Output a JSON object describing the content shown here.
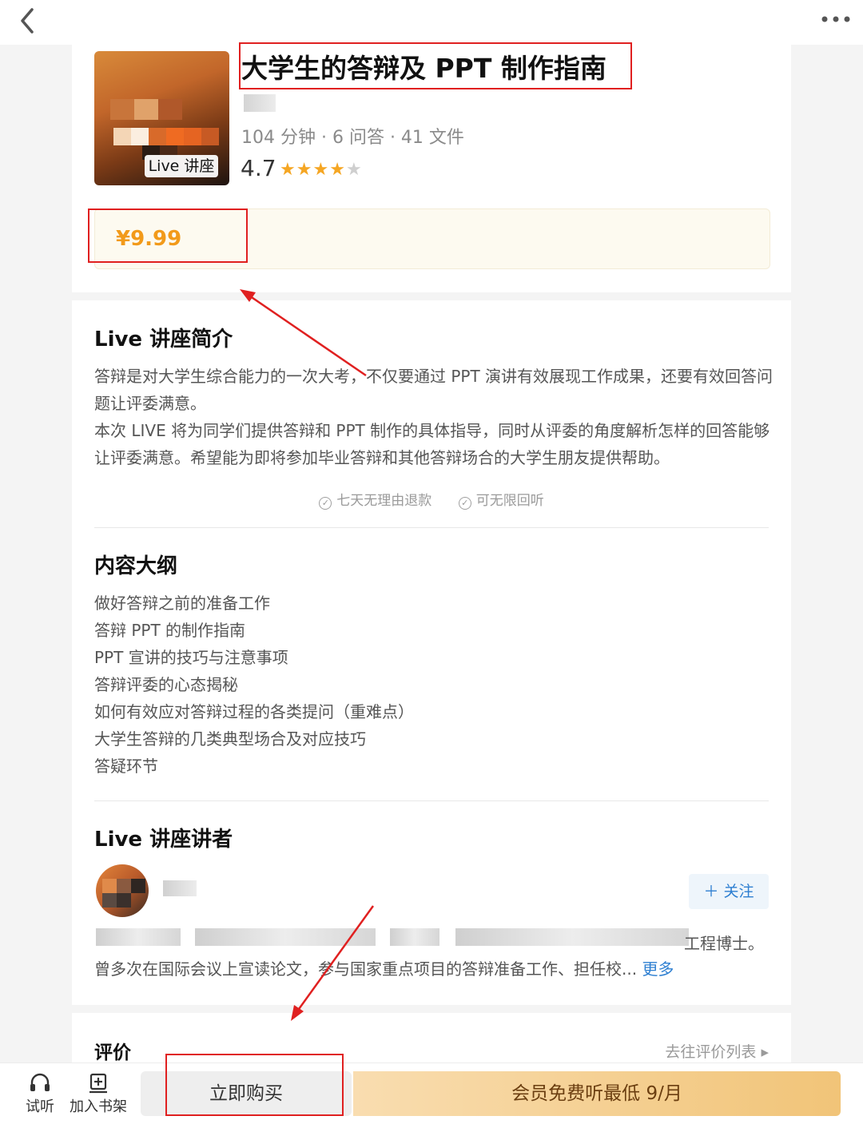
{
  "course": {
    "title": "大学生的答辩及 PPT 制作指南",
    "meta": "104 分钟 · 6 问答 · 41 文件",
    "rating": "4.7",
    "rating_stars": 4,
    "cover_badge": "Live 讲座",
    "price": "¥9.99"
  },
  "intro": {
    "title": "Live 讲座简介",
    "paragraphs": [
      "答辩是对大学生综合能力的一次大考，不仅要通过 PPT 演讲有效展现工作成果，还要有效回答问题让评委满意。",
      "本次 LIVE 将为同学们提供答辩和 PPT 制作的具体指导，同时从评委的角度解析怎样的回答能够让评委满意。希望能为即将参加毕业答辩和其他答辩场合的大学生朋友提供帮助。"
    ],
    "guarantees": [
      "七天无理由退款",
      "可无限回听"
    ]
  },
  "outline": {
    "title": "内容大纲",
    "items": [
      "做好答辩之前的准备工作",
      "答辩 PPT 的制作指南",
      "PPT 宣讲的技巧与注意事项",
      "答辩评委的心态揭秘",
      "如何有效应对答辩过程的各类提问（重难点）",
      "大学生答辩的几类典型场合及对应技巧",
      "答疑环节"
    ]
  },
  "speaker": {
    "title": "Live 讲座讲者",
    "follow_label": "＋ 关注",
    "bio_line1_visible": "工程博士。",
    "bio_line2": "曾多次在国际会议上宣读论文，参与国家重点项目的答辩准备工作、担任校...",
    "more_label": "更多"
  },
  "reviews": {
    "title": "评价",
    "link_label": "去往评价列表 ▸"
  },
  "bottom_bar": {
    "listen_label": "试听",
    "bookshelf_label": "加入书架",
    "buy_label": "立即购买",
    "vip_label": "会员免费听最低 9/月"
  },
  "colors": {
    "price": "#f29a1a",
    "star": "#f5a623",
    "link": "#2e7fd1",
    "annotation": "#e02020",
    "vip_gradient_start": "#f9ddb0",
    "vip_gradient_end": "#f1c478"
  }
}
